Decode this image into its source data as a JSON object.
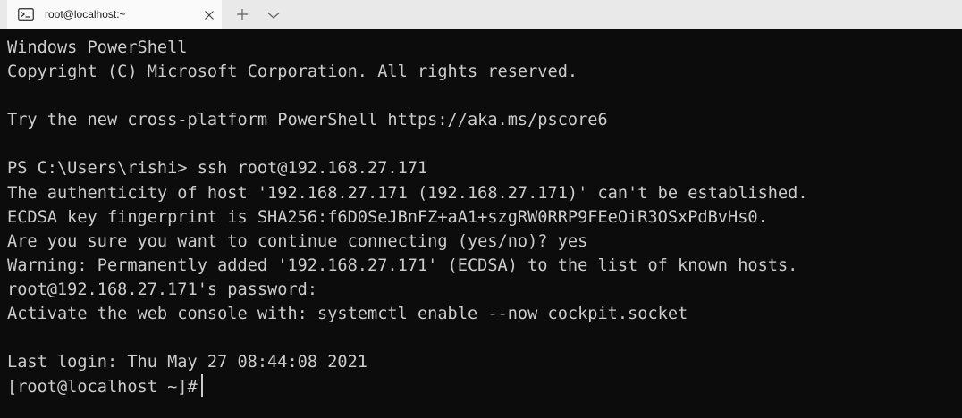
{
  "tab": {
    "title": "root@localhost:~",
    "icon": "terminal-icon",
    "close_icon": "close-icon"
  },
  "toolbar": {
    "new_tab_icon": "plus-icon",
    "dropdown_icon": "chevron-down-icon"
  },
  "terminal": {
    "lines": [
      "Windows PowerShell",
      "Copyright (C) Microsoft Corporation. All rights reserved.",
      "",
      "Try the new cross-platform PowerShell https://aka.ms/pscore6",
      "",
      "PS C:\\Users\\rishi> ssh root@192.168.27.171",
      "The authenticity of host '192.168.27.171 (192.168.27.171)' can't be established.",
      "ECDSA key fingerprint is SHA256:f6D0SeJBnFZ+aA1+szgRW0RRP9FEeOiR3OSxPdBvHs0.",
      "Are you sure you want to continue connecting (yes/no)? yes",
      "Warning: Permanently added '192.168.27.171' (ECDSA) to the list of known hosts.",
      "root@192.168.27.171's password:",
      "Activate the web console with: systemctl enable --now cockpit.socket",
      "",
      "Last login: Thu May 27 08:44:08 2021"
    ],
    "prompt": "[root@localhost ~]#"
  },
  "colors": {
    "background": "#0c0c0c",
    "foreground": "#cccccc",
    "tabbar": "#e9e9e9",
    "active_tab": "#fafafa"
  }
}
